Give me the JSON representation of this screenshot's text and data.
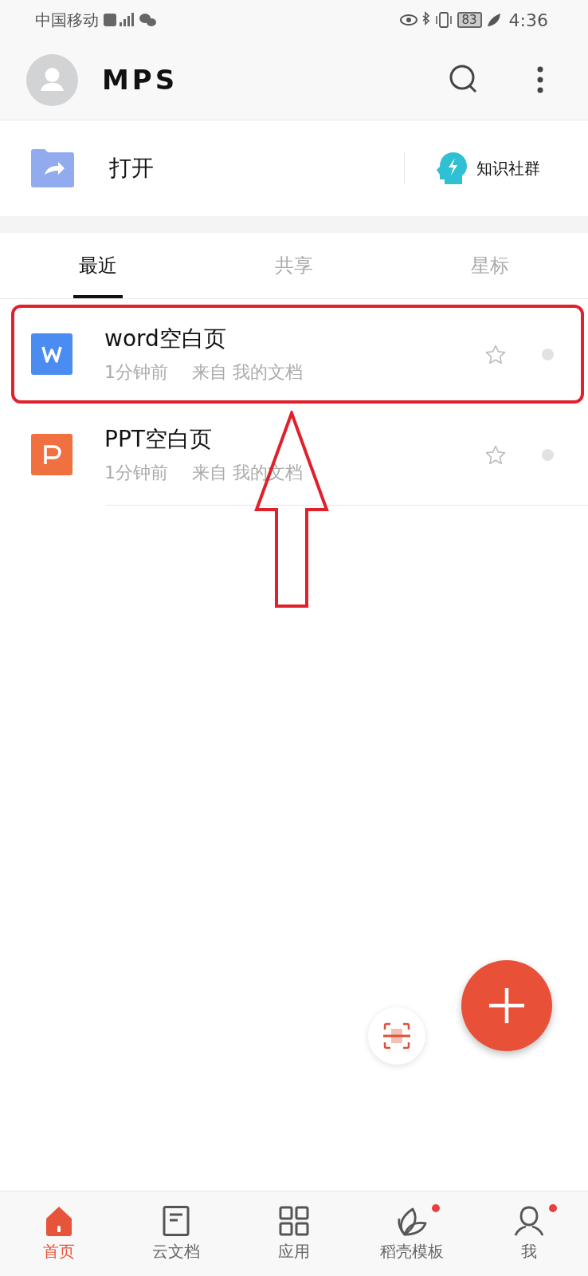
{
  "status_bar": {
    "carrier": "中国移动",
    "battery": "83",
    "time": "4:36"
  },
  "header": {
    "logo": "MPS"
  },
  "quick_actions": [
    {
      "kind": "open",
      "label": "打开"
    },
    {
      "kind": "community",
      "label": "知识社群"
    }
  ],
  "tabs": [
    {
      "label": "最近",
      "selected": true
    },
    {
      "label": "共享",
      "selected": false
    },
    {
      "label": "星标",
      "selected": false
    }
  ],
  "files": [
    {
      "kind": "word",
      "name": "word空白页",
      "time": "1分钟前",
      "source": "来自 我的文档",
      "starred": false,
      "highlighted": true
    },
    {
      "kind": "ppt",
      "name": "PPT空白页",
      "time": "1分钟前",
      "source": "来自 我的文档",
      "starred": false,
      "highlighted": false
    }
  ],
  "bottom_nav": [
    {
      "kind": "home",
      "label": "首页",
      "selected": true,
      "badge": false
    },
    {
      "kind": "docs",
      "label": "云文档",
      "selected": false,
      "badge": false
    },
    {
      "kind": "apps",
      "label": "应用",
      "selected": false,
      "badge": false
    },
    {
      "kind": "templates",
      "label": "稻壳模板",
      "selected": false,
      "badge": true
    },
    {
      "kind": "me",
      "label": "我",
      "selected": false,
      "badge": true
    }
  ]
}
